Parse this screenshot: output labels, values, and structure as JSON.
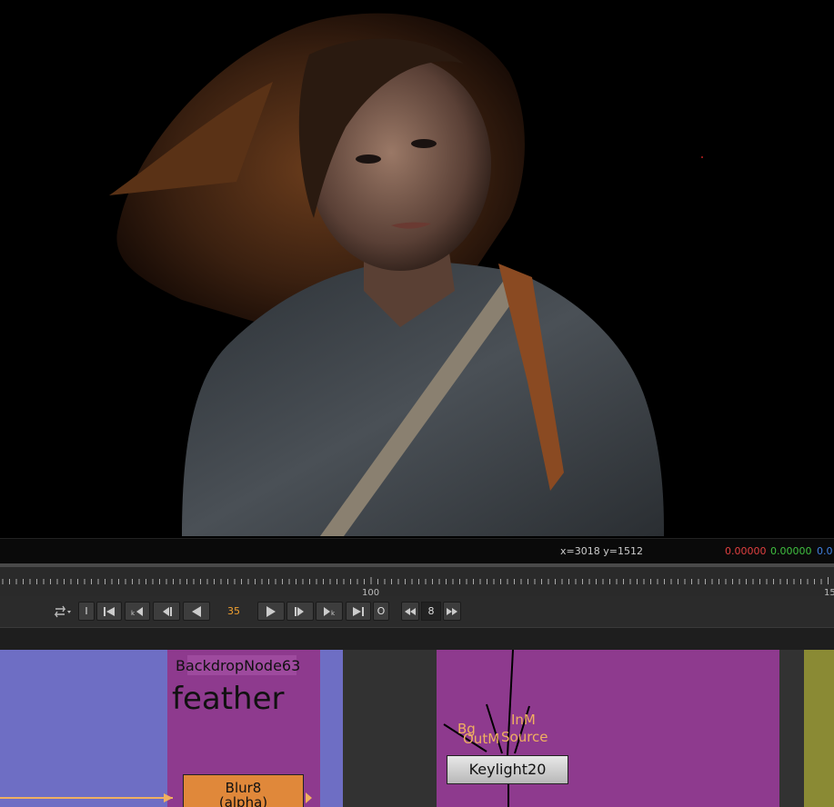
{
  "viewer": {
    "coords": "x=3018 y=1512",
    "pixel_values": {
      "r": "0.00000",
      "g": "0.00000",
      "b": "0.0"
    },
    "colors": {
      "r": "#e04040",
      "g": "#40c040",
      "b": "#4080e0"
    }
  },
  "timeline": {
    "tick_100": "100",
    "tick_150": "15"
  },
  "controls": {
    "loop_icon": "loop-mode-icon",
    "in_label": "I",
    "out_label": "O",
    "current_frame": "35",
    "increment": "8"
  },
  "nodegraph": {
    "backdrop_title": "BackdropNode63",
    "backdrop_note": "feather",
    "blur_node": {
      "name": "Blur8",
      "sub": "(alpha)"
    },
    "keylight_node": {
      "name": "Keylight20"
    },
    "inputs": {
      "bg": "Bg",
      "outm": "OutM",
      "inm": "InM",
      "source": "Source"
    },
    "colors": {
      "blue_backdrop": "#6e6ec4",
      "purple_backdrop": "#8e3a8e",
      "olive_backdrop": "#8a8a34",
      "blur_node": "#e0883a",
      "keylight_node": "#d8d8d8",
      "input_label": "#f0b060"
    }
  }
}
